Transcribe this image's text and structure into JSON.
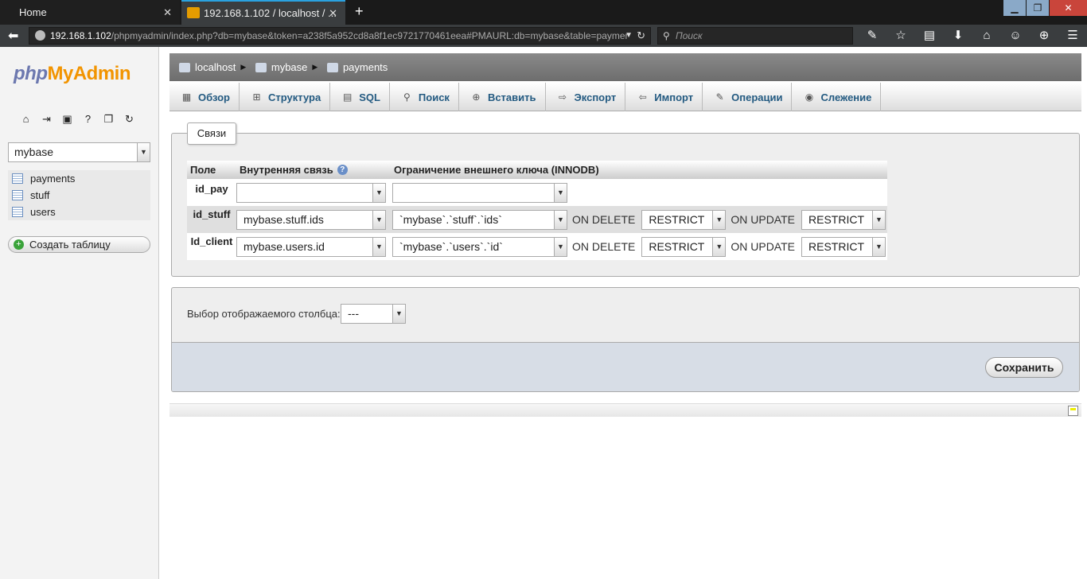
{
  "browser": {
    "tabs": [
      {
        "title": "Home"
      },
      {
        "title": "192.168.1.102 / localhost / ..."
      }
    ],
    "url_host": "192.168.1.102",
    "url_path": "/phpmyadmin/index.php?db=mybase&token=a238f5a952cd8a8f1ec9721770461eea#PMAURL:db=mybase&table=paymer",
    "search_placeholder": "Поиск"
  },
  "sidebar": {
    "logo": {
      "php": "php",
      "my": "My",
      "admin": "Admin"
    },
    "db_selected": "mybase",
    "tables": [
      "payments",
      "stuff",
      "users"
    ],
    "new_table": "Создать таблицу"
  },
  "breadcrumb": {
    "server": "localhost",
    "db": "mybase",
    "table": "payments"
  },
  "tabs": [
    "Обзор",
    "Структура",
    "SQL",
    "Поиск",
    "Вставить",
    "Экспорт",
    "Импорт",
    "Операции",
    "Слежение"
  ],
  "relations": {
    "legend": "Связи",
    "headers": {
      "field": "Поле",
      "internal": "Внутренняя связь",
      "fk": "Ограничение внешнего ключа (INNODB)"
    },
    "on_delete": "ON DELETE",
    "on_update": "ON UPDATE",
    "rows": [
      {
        "field": "id_pay",
        "internal": "",
        "fk": "",
        "del": "",
        "upd": ""
      },
      {
        "field": "id_stuff",
        "internal": "mybase.stuff.ids",
        "fk": "`mybase`.`stuff`.`ids`",
        "del": "RESTRICT",
        "upd": "RESTRICT"
      },
      {
        "field": "Id_client",
        "internal": "mybase.users.id",
        "fk": "`mybase`.`users`.`id`",
        "del": "RESTRICT",
        "upd": "RESTRICT"
      }
    ]
  },
  "display": {
    "label": "Выбор отображаемого столбца:",
    "value": "---"
  },
  "save_label": "Сохранить"
}
